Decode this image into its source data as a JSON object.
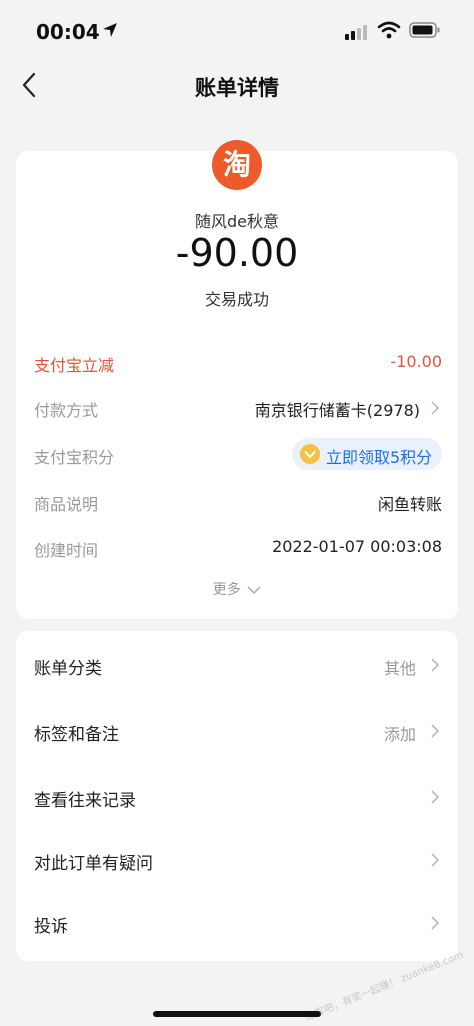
{
  "status_bar": {
    "time": "00:04"
  },
  "nav": {
    "title": "账单详情"
  },
  "merchant": {
    "logo_char": "淘",
    "name": "随风de秋意",
    "logo_color": "#ef5a2b"
  },
  "transaction": {
    "amount": "-90.00",
    "status": "交易成功"
  },
  "details": [
    {
      "label": "支付宝立减",
      "value": "-10.00"
    },
    {
      "label": "付款方式",
      "value": "南京银行储蓄卡(2978)"
    },
    {
      "label": "支付宝积分",
      "value": "立即领取5积分"
    },
    {
      "label": "商品说明",
      "value": "闲鱼转账"
    },
    {
      "label": "创建时间",
      "value": "2022-01-07 00:03:08"
    }
  ],
  "more_label": "更多",
  "menu": [
    {
      "label": "账单分类",
      "value": "其他"
    },
    {
      "label": "标签和备注",
      "value": "添加"
    },
    {
      "label": "查看往来记录",
      "value": ""
    },
    {
      "label": "对此订单有疑问",
      "value": ""
    },
    {
      "label": "投诉",
      "value": ""
    }
  ],
  "watermark": "赚客吧，有奖一起赚！ zuanke8.com",
  "colors": {
    "accent_red": "#e4533f",
    "link_blue": "#1f6fe5",
    "background": "#f3f3f3"
  }
}
